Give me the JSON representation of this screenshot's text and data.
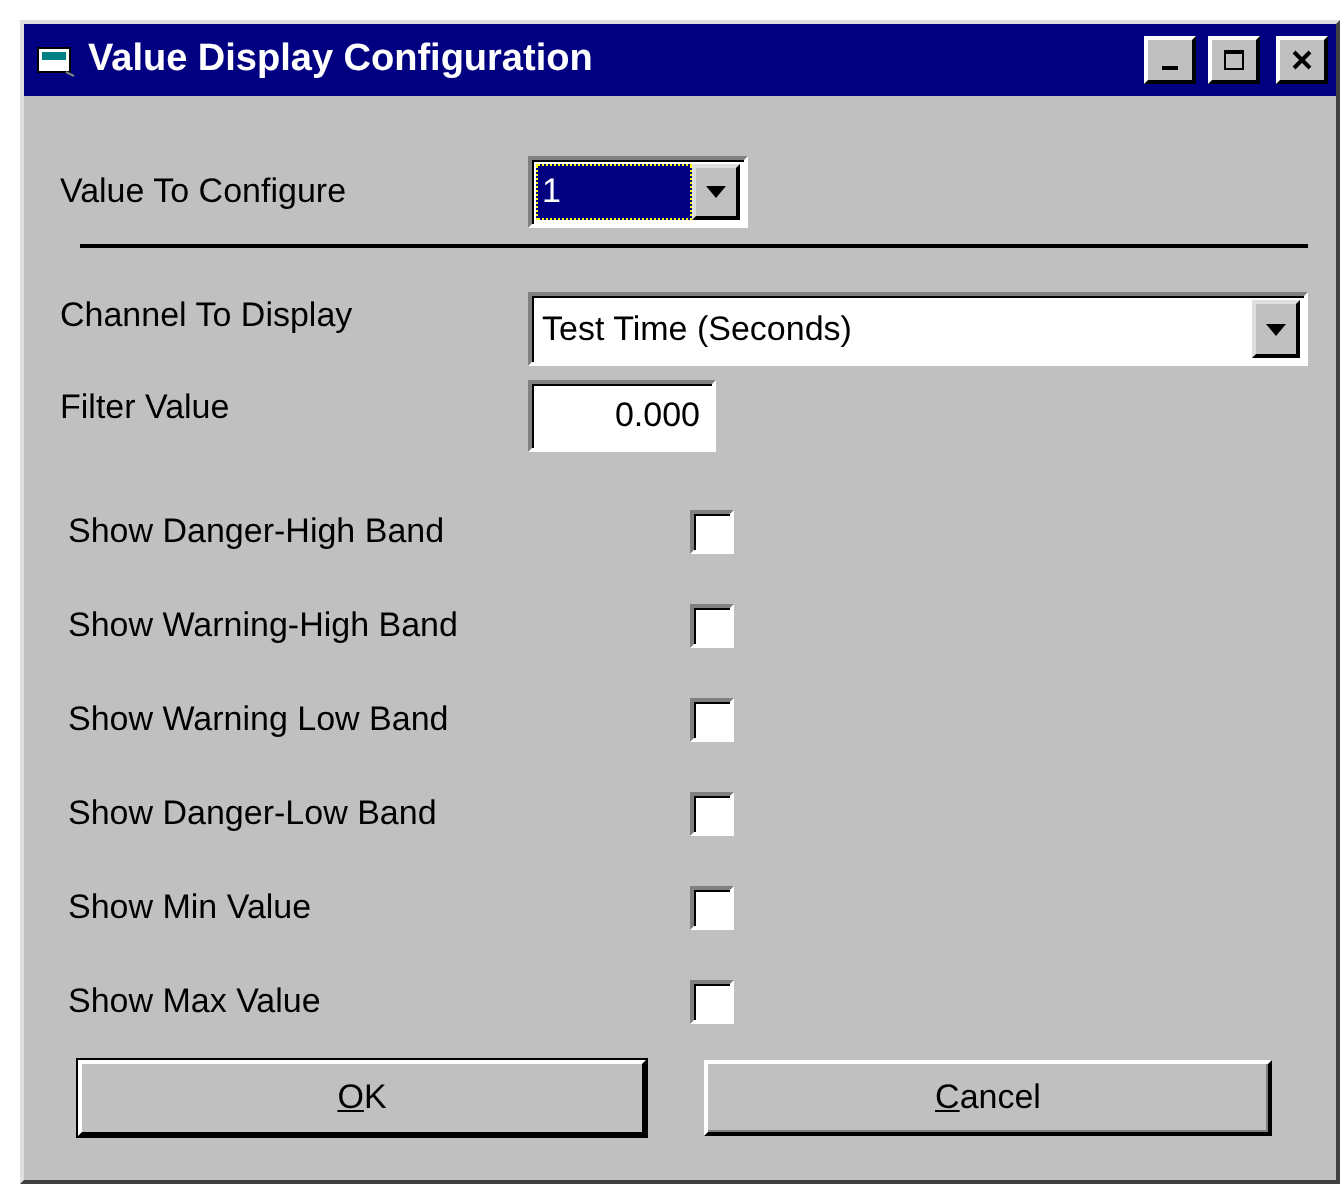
{
  "window": {
    "title": "Value Display Configuration"
  },
  "value_to_configure": {
    "label": "Value To Configure",
    "value": "1",
    "focused": true
  },
  "channel_to_display": {
    "label": "Channel To Display",
    "value": "Test Time (Seconds)"
  },
  "filter_value": {
    "label": "Filter Value",
    "value": "0.000"
  },
  "options": [
    {
      "label": "Show Danger-High Band",
      "checked": false
    },
    {
      "label": "Show Warning-High Band",
      "checked": false
    },
    {
      "label": "Show Warning Low Band",
      "checked": false
    },
    {
      "label": "Show Danger-Low Band",
      "checked": false
    },
    {
      "label": "Show Min Value",
      "checked": false
    },
    {
      "label": "Show Max Value",
      "checked": false
    }
  ],
  "buttons": [
    {
      "label": "OK",
      "first_letter_underlined": true,
      "default": true
    },
    {
      "label": "Cancel",
      "first_letter_underlined": true,
      "default": false
    }
  ]
}
